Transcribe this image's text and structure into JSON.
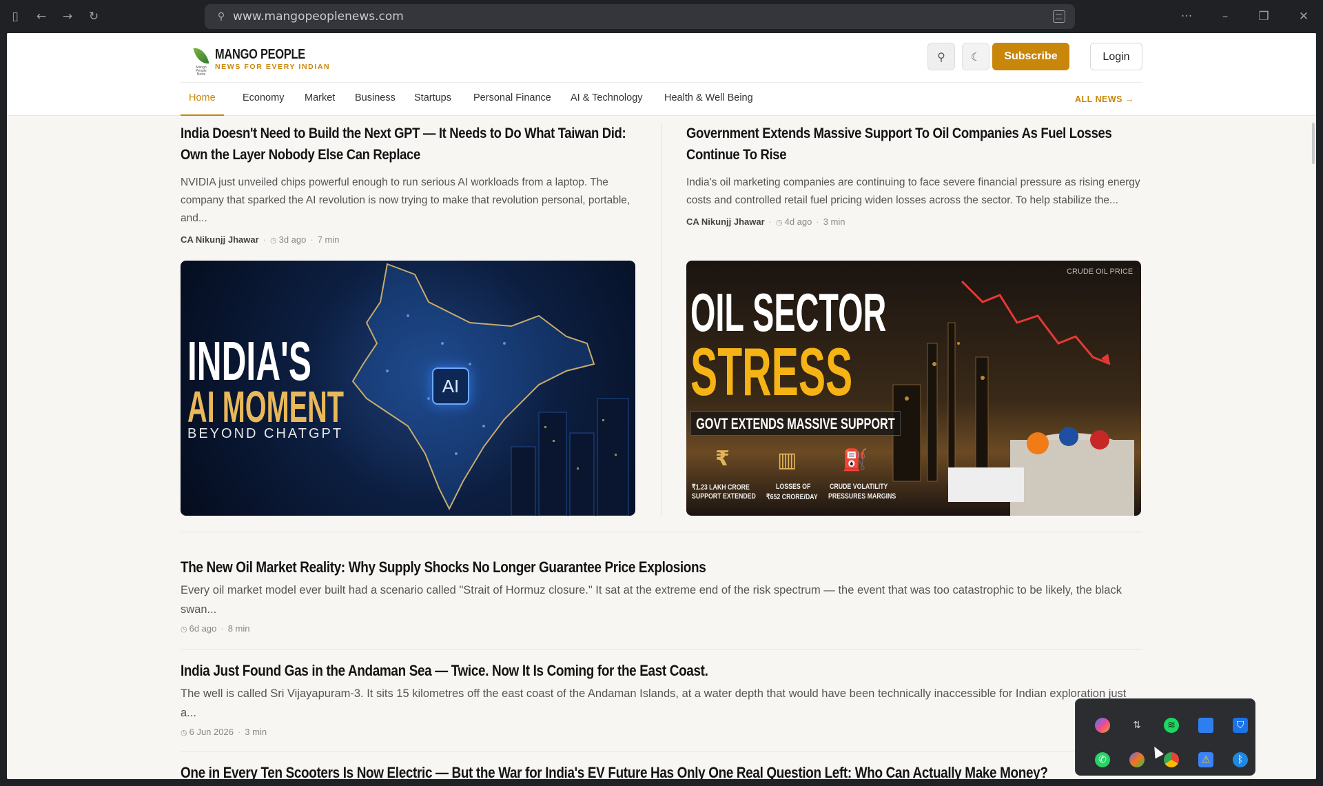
{
  "browser": {
    "url": "www.mangopeoplenews.com"
  },
  "site": {
    "logo_small_text": "Mango People News",
    "name": "MANGO PEOPLE",
    "tagline": "NEWS FOR EVERY INDIAN",
    "subscribe_label": "Subscribe",
    "login_label": "Login"
  },
  "nav": {
    "items": [
      "Home",
      "Economy",
      "Market",
      "Business",
      "Startups",
      "Personal Finance",
      "AI & Technology",
      "Health & Well Being"
    ],
    "active": "Home",
    "all_news": "ALL NEWS →"
  },
  "featured": [
    {
      "title": "India Doesn't Need to Build the Next GPT — It Needs to Do What Taiwan Did: Own the Layer Nobody Else Can Replace",
      "excerpt": "NVIDIA just unveiled chips powerful enough to run serious AI workloads from a laptop. The company that sparked the AI revolution is now trying to make that revolution personal, portable, and...",
      "author": "CA Nikunjj Jhawar",
      "age": "3d ago",
      "read": "7 min",
      "image_text": {
        "line1": "INDIA'S",
        "line2": "AI MOMENT",
        "line3": "BEYOND CHATGPT",
        "chip": "AI"
      }
    },
    {
      "title": "Government Extends Massive Support To Oil Companies As Fuel Losses Continue To Rise",
      "excerpt": "India's oil marketing companies are continuing to face severe financial pressure as rising energy costs and controlled retail fuel pricing widen losses across the sector. To help stabilize the...",
      "author": "CA Nikunjj Jhawar",
      "age": "4d ago",
      "read": "3 min",
      "image_text": {
        "line1": "OIL SECTOR",
        "line2": "STRESS",
        "banner": "GOVT EXTENDS MASSIVE SUPPORT",
        "corner": "CRUDE OIL PRICE",
        "stat1a": "₹1.23 LAKH CRORE",
        "stat1b": "SUPPORT EXTENDED",
        "stat2a": "LOSSES OF",
        "stat2b": "₹652 CRORE/DAY",
        "stat3a": "CRUDE VOLATILITY",
        "stat3b": "PRESSURES MARGINS"
      }
    }
  ],
  "articles": [
    {
      "title": "The New Oil Market Reality: Why Supply Shocks No Longer Guarantee Price Explosions",
      "excerpt": "Every oil market model ever built had a scenario called \"Strait of Hormuz closure.\" It sat at the extreme end of the risk spectrum — the event that was too catastrophic to be likely, the black swan...",
      "age": "6d ago",
      "read": "8 min"
    },
    {
      "title": "India Just Found Gas in the Andaman Sea — Twice. Now It Is Coming for the East Coast.",
      "excerpt": "The well is called Sri Vijayapuram-3. It sits 15 kilometres off the east coast of the Andaman Islands, at a water depth that would have been technically inaccessible for Indian exploration just a...",
      "age": "6 Jun 2026",
      "read": "3 min"
    },
    {
      "title": "One in Every Ten Scooters Is Now Electric — But the War for India's EV Future Has Only One Real Question Left: Who Can Actually Make Money?"
    }
  ],
  "tray": {
    "icons": [
      "copilot-icon",
      "sync-icon",
      "spotify-icon",
      "remote-desktop-icon",
      "defender-icon",
      "whatsapp-icon",
      "copilot-app-icon",
      "chrome-icon",
      "security-warning-icon",
      "bluetooth-icon"
    ]
  },
  "colors": {
    "accent": "#c8860a",
    "page_bg": "#f7f6f3"
  }
}
